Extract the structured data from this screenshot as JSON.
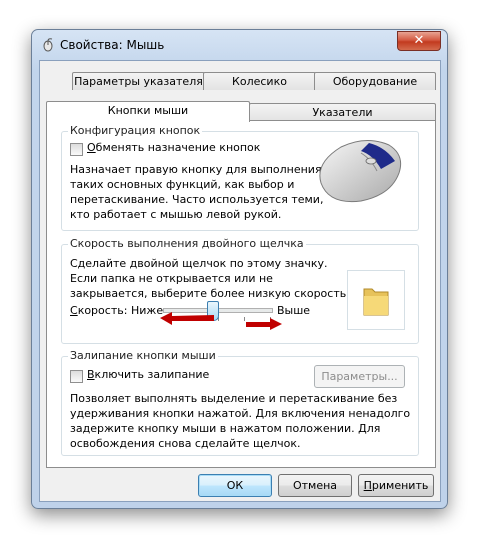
{
  "window": {
    "title": "Свойства: Мышь",
    "close": "✕"
  },
  "tabs": {
    "row1": [
      "Параметры указателя",
      "Колесико",
      "Оборудование"
    ],
    "row2": [
      "Кнопки мыши",
      "Указатели"
    ],
    "active": "Кнопки мыши"
  },
  "button_config": {
    "title": "Конфигурация кнопок",
    "checkbox_label_u": "О",
    "checkbox_label_rest": "бменять назначение кнопок",
    "checked": false,
    "description": [
      "Назначает правую кнопку для выполнения",
      "таких основных функций, как выбор и",
      "перетаскивание. Часто используется теми,",
      "кто работает с мышью левой рукой."
    ]
  },
  "double_click": {
    "title": "Скорость выполнения двойного щелчка",
    "description": [
      "Сделайте двойной щелчок по этому значку.",
      "Если папка не открывается или не",
      "закрывается, выберите более низкую скорость."
    ],
    "speed_label_u": "С",
    "speed_label_rest": "корость:",
    "low": "Ниже",
    "high": "Выше",
    "speed_level_fraction": 0.45
  },
  "click_lock": {
    "title": "Залипание кнопки мыши",
    "checkbox_label_u": "В",
    "checkbox_label_rest": "ключить залипание",
    "checked": false,
    "settings_button": "Параметры...",
    "description": [
      "Позволяет выполнять выделение и перетаскивание без",
      "удерживания кнопки нажатой. Для включения ненадолго",
      "задержите кнопку мыши в нажатом положении. Для",
      "освобождения снова сделайте щелчок."
    ]
  },
  "footer": {
    "ok": "ОК",
    "cancel": "Отмена",
    "apply_u": "П",
    "apply_rest": "рименить"
  },
  "colors": {
    "annotation_arrow": "#c00000",
    "title_bar": "#c2d5ec"
  }
}
